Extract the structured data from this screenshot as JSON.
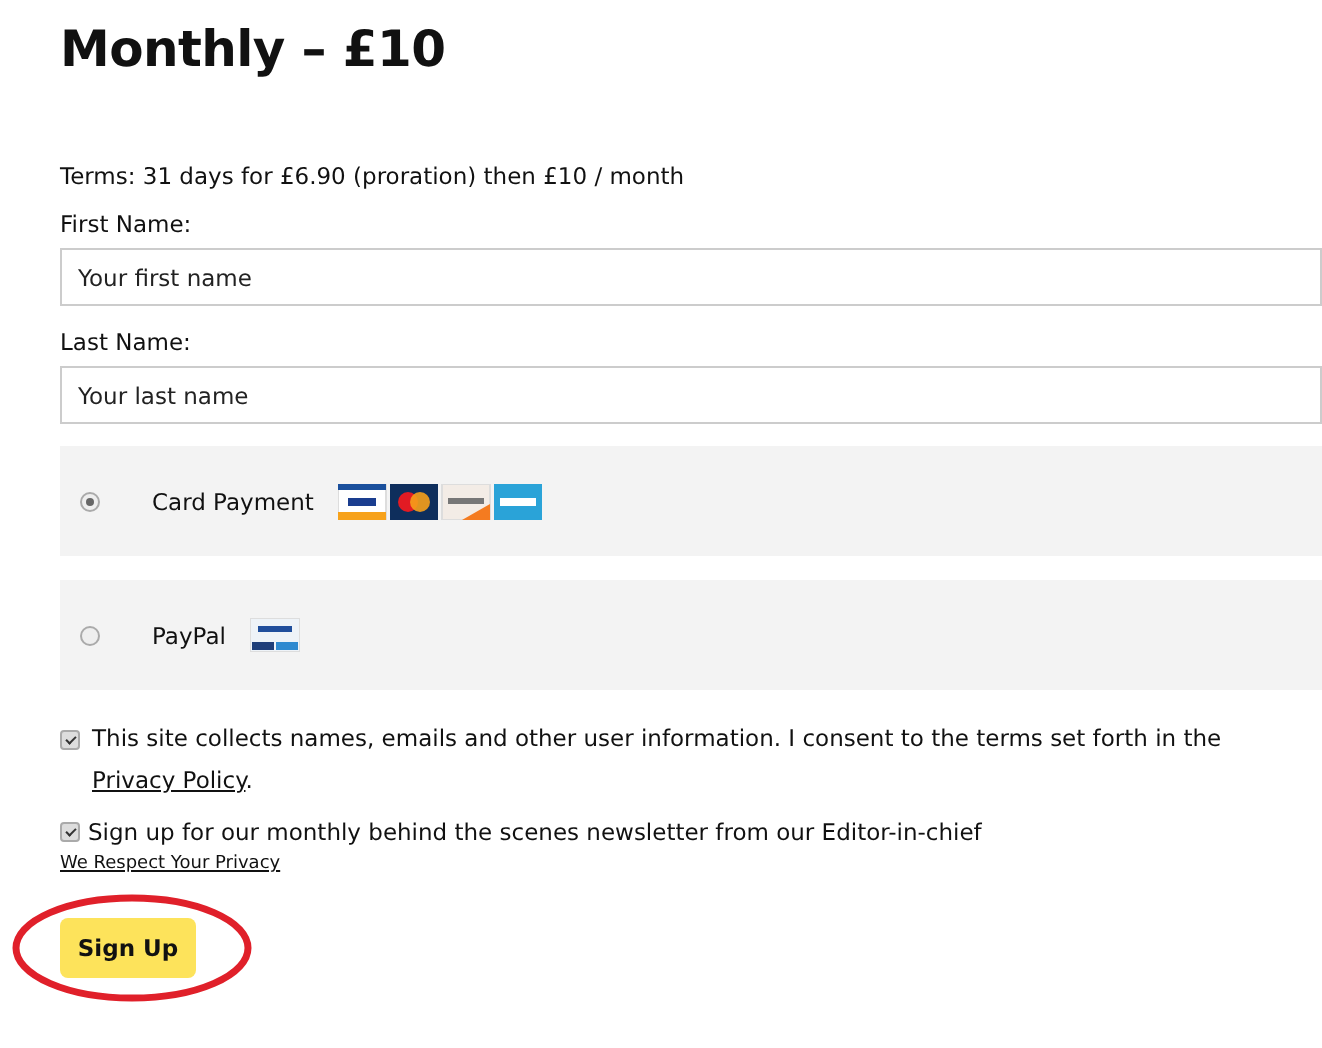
{
  "title": "Monthly – £10",
  "terms": "Terms: 31 days for £6.90 (proration) then £10 / month",
  "fields": [
    {
      "label": "First Name:",
      "placeholder": "Your first name"
    },
    {
      "label": "Last Name:",
      "placeholder": "Your last name"
    }
  ],
  "payment_methods": [
    {
      "label": "Card Payment",
      "selected": true,
      "kind": "cards"
    },
    {
      "label": "PayPal",
      "selected": false,
      "kind": "paypal"
    }
  ],
  "consent": {
    "checked": true,
    "text": "This site collects names, emails and other user information. I consent to the terms set forth in the",
    "link": "Privacy Policy",
    "after": "."
  },
  "newsletter": {
    "checked": true,
    "text": "Sign up for our monthly behind the scenes newsletter from our Editor-in-chief",
    "link": "We Respect Your Privacy"
  },
  "submit": "Sign Up"
}
